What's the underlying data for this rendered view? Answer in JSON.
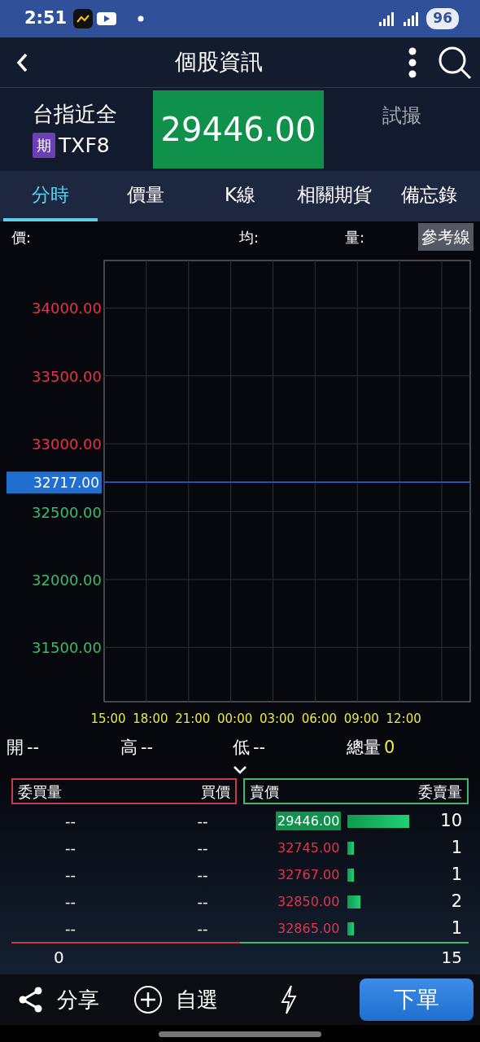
{
  "status_bar": {
    "time": "2:51",
    "battery": "96"
  },
  "header": {
    "title": "個股資訊"
  },
  "quote": {
    "name": "台指近全",
    "badge": "期",
    "symbol": "TXF8",
    "price": "29446.00",
    "state": "試撮"
  },
  "tabs": [
    {
      "label": "分時",
      "selected": true
    },
    {
      "label": "價量",
      "selected": false
    },
    {
      "label": "K線",
      "selected": false
    },
    {
      "label": "相關期貨",
      "selected": false
    },
    {
      "label": "備忘錄",
      "selected": false
    }
  ],
  "chart_info": {
    "labels": [
      "價:",
      "均:",
      "量:"
    ],
    "button": "參考線"
  },
  "chart": {
    "y_labels": [
      {
        "label": "34000.00",
        "color": "#e8334a"
      },
      {
        "label": "33500.00",
        "color": "#e8334a"
      },
      {
        "label": "33000.00",
        "color": "#e8334a"
      },
      {
        "label": "32500.00",
        "color": "#3dbb6a"
      },
      {
        "label": "32000.00",
        "color": "#3dbb6a"
      },
      {
        "label": "31500.00",
        "color": "#3dbb6a"
      }
    ],
    "reference": "32717.00",
    "x_labels": [
      "15:00",
      "18:00",
      "21:00",
      "00:00",
      "03:00",
      "06:00",
      "09:00",
      "12:00"
    ]
  },
  "stats": [
    {
      "label": "開",
      "value": "--"
    },
    {
      "label": "高",
      "value": "--"
    },
    {
      "label": "低",
      "value": "--"
    },
    {
      "label": "總量",
      "value": "0"
    }
  ],
  "order_book": {
    "bid_headers": [
      "委買量",
      "買價"
    ],
    "ask_headers": [
      "賣價",
      "委賣量"
    ],
    "rows": [
      {
        "bid_qty": "--",
        "bid_price": "--",
        "ask_price": "29446.00",
        "highlighted": true,
        "ask_qty": "10"
      },
      {
        "bid_qty": "--",
        "bid_price": "--",
        "ask_price": "32745.00",
        "highlighted": false,
        "ask_qty": "1"
      },
      {
        "bid_qty": "--",
        "bid_price": "--",
        "ask_price": "32767.00",
        "highlighted": false,
        "ask_qty": "1"
      },
      {
        "bid_qty": "--",
        "bid_price": "--",
        "ask_price": "32850.00",
        "highlighted": false,
        "ask_qty": "2"
      },
      {
        "bid_qty": "--",
        "bid_price": "--",
        "ask_price": "32865.00",
        "highlighted": false,
        "ask_qty": "1"
      }
    ],
    "bid_total": "0",
    "ask_total": "15"
  },
  "bottom_bar": {
    "share": "分享",
    "watchlist": "自選",
    "order": "下單"
  }
}
